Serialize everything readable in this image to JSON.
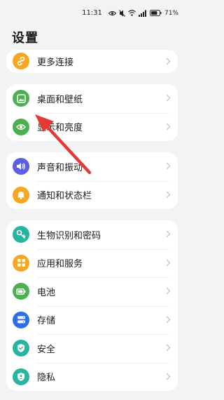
{
  "status_bar": {
    "time": "11:31",
    "battery_percent": "71%"
  },
  "page": {
    "title": "设置"
  },
  "groups": [
    {
      "items": [
        {
          "label": "更多连接",
          "icon": "link-icon",
          "color": "#f5a623"
        }
      ]
    },
    {
      "items": [
        {
          "label": "桌面和壁纸",
          "icon": "wallpaper-icon",
          "color": "#4caf50"
        },
        {
          "label": "显示和亮度",
          "icon": "eye-icon",
          "color": "#4caf50"
        }
      ]
    },
    {
      "items": [
        {
          "label": "声音和振动",
          "icon": "speaker-icon",
          "color": "#5b5fe0"
        },
        {
          "label": "通知和状态栏",
          "icon": "bell-icon",
          "color": "#f5a623"
        }
      ]
    },
    {
      "items": [
        {
          "label": "生物识别和密码",
          "icon": "key-icon",
          "color": "#26b5a0"
        },
        {
          "label": "应用和服务",
          "icon": "apps-icon",
          "color": "#f5a623"
        },
        {
          "label": "电池",
          "icon": "battery-icon",
          "color": "#4caf50"
        },
        {
          "label": "存储",
          "icon": "storage-icon",
          "color": "#2f6fe6"
        },
        {
          "label": "安全",
          "icon": "shield-icon",
          "color": "#26b5a0"
        },
        {
          "label": "隐私",
          "icon": "privacy-icon",
          "color": "#26b5a0"
        }
      ]
    }
  ],
  "annotation": {
    "color": "#e53935"
  }
}
